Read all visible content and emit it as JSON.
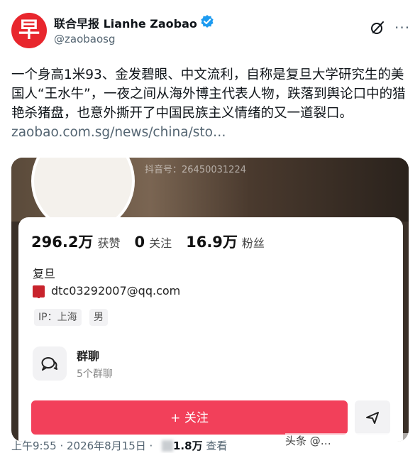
{
  "account": {
    "avatar_char": "早",
    "display_name": "联合早报 Lianhe Zaobao",
    "handle": "@zaobaosg",
    "brand_color": "#e8262d",
    "verified_color": "#1d9bf0"
  },
  "tweet": {
    "text": "一个身高1米93、金发碧眼、中文流利，自称是复旦大学研究生的美国人“王水牛”，一夜之间从海外博主代表人物，跌落到舆论口中的猎艳杀猪盘，也意外撕开了中国民族主义情绪的又一道裂口。",
    "link": "zaobao.com.sg/news/china/sto…"
  },
  "card": {
    "douyin_id": "抖音号：26450031224",
    "stats": [
      {
        "value": "296.2万",
        "label": "获赞"
      },
      {
        "value": "0",
        "label": "关注"
      },
      {
        "value": "16.9万",
        "label": "粉丝"
      }
    ],
    "school": "复旦",
    "email": "dtc03292007@qq.com",
    "tags": {
      "ip": "IP：上海",
      "gender": "男"
    },
    "group": {
      "title": "群聊",
      "subtitle": "5个群聊"
    },
    "follow_label": "+ 关注",
    "dm_icon": "send-icon",
    "follow_color": "#f2405a"
  },
  "footer": {
    "timestamp": "上午9:55 · 2026年8月15日 ·",
    "views_count": "1.8万",
    "views_label": "查看",
    "watermark": "头条 @…"
  }
}
